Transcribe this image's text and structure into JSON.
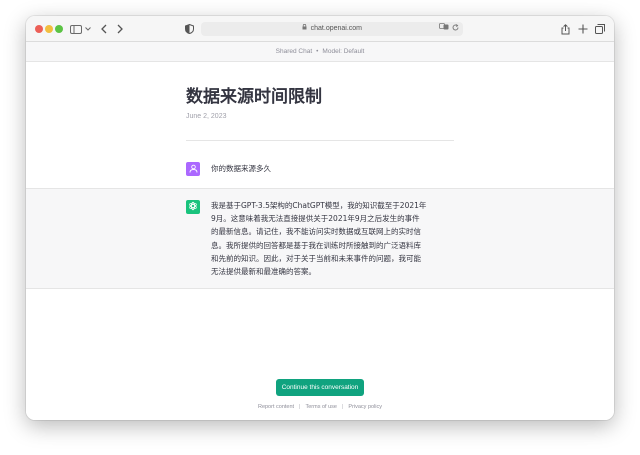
{
  "browser": {
    "url": "chat.openai.com"
  },
  "shared_bar": {
    "label": "Shared Chat",
    "separator": "•",
    "model": "Model: Default"
  },
  "conversation": {
    "title": "数据来源时间限制",
    "date": "June 2, 2023",
    "user_message": "你的数据来源多久",
    "assistant_message": "我是基于GPT-3.5架构的ChatGPT模型，我的知识截至于2021年9月。这意味着我无法直接提供关于2021年9月之后发生的事件的最新信息。请记住，我不能访问实时数据或互联网上的实时信息。我所提供的回答都是基于我在训练时所接触到的广泛语料库和先前的知识。因此，对于关于当前和未来事件的问题，我可能无法提供最新和最准确的答案。"
  },
  "actions": {
    "continue_label": "Continue this conversation"
  },
  "footer": {
    "report": "Report content",
    "terms": "Terms of use",
    "privacy": "Privacy policy",
    "sep": "|"
  },
  "colors": {
    "accent": "#10a37f",
    "user_avatar": "#ab68ff",
    "assistant_avatar": "#19c37d"
  },
  "icons": [
    "sidebar-icon",
    "chevron-down-icon",
    "back-icon",
    "forward-icon",
    "shield-icon",
    "lock-icon",
    "translate-icon",
    "reload-icon",
    "share-icon",
    "plus-icon",
    "tabs-icon",
    "user-icon",
    "openai-logo-icon"
  ]
}
